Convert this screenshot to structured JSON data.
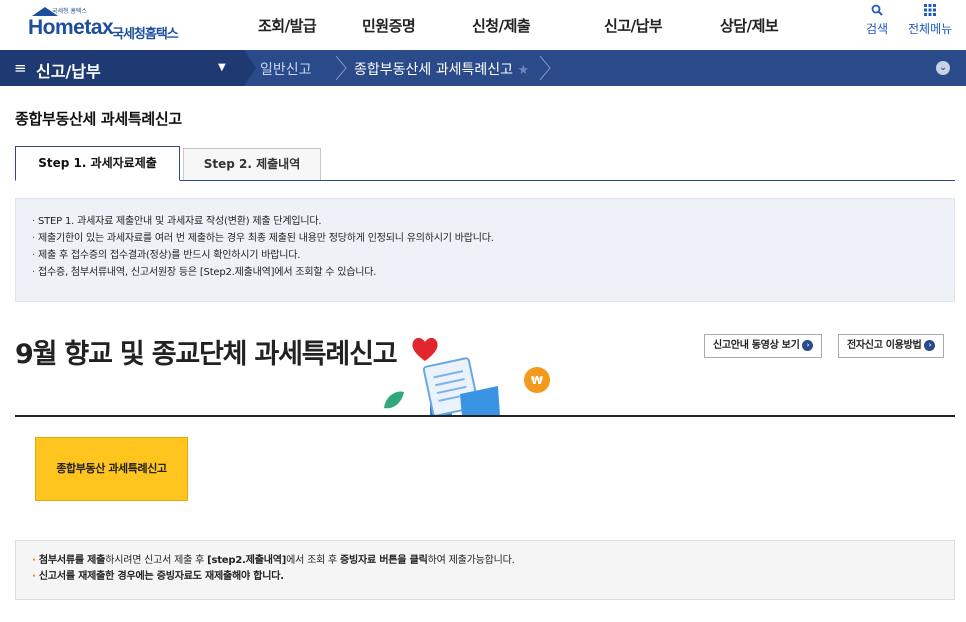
{
  "header": {
    "logo_small": "국세청 홈택스",
    "logo_text": "Hometax",
    "logo_kr": "국세청홈택스",
    "nav": [
      "조회/발급",
      "민원증명",
      "신청/제출",
      "신고/납부",
      "상담/제보"
    ],
    "util": {
      "search_label": "검색",
      "menu_label": "전체메뉴"
    }
  },
  "navbar": {
    "menu_label": "신고/납부",
    "crumbs": [
      "일반신고",
      "종합부동산세 과세특례신고"
    ]
  },
  "page": {
    "title": "종합부동산세 과세특례신고",
    "tabs": [
      {
        "label": "Step 1. 과세자료제출"
      },
      {
        "label": "Step 2. 제출내역"
      }
    ],
    "info_items": [
      "STEP 1. 과세자료 제출안내 및 과세자료 작성(변환) 제출 단계입니다.",
      "제출기한이 있는 과세자료를 여러 번 제출하는 경우 최종 제출된 내용만 정당하게 인정되니 유의하시기 바랍니다.",
      "제출 후 접수증의 접수결과(정상)를 반드시 확인하시기 바랍니다.",
      "접수증, 첨부서류내역, 신고서원장 등은 [Step2.제출내역]에서 조회할 수 있습니다."
    ]
  },
  "banner": {
    "title": "9월 향교 및 종교단체 과세특례신고",
    "btn_video": "신고안내 동영상 보기",
    "btn_howto": "전자신고 이용방법"
  },
  "action": {
    "yellow_button": "종합부동산 과세특례신고"
  },
  "notice": {
    "line1_a": "첨부서류를 제출",
    "line1_b": "하시려면 신고서 제출 후 ",
    "line1_c": "[step2.제출내역]",
    "line1_d": "에서 조회 후 ",
    "line1_e": "증빙자료 버튼을 클릭",
    "line1_f": "하여 제출가능합니다.",
    "line2": "신고서를 재제출한 경우에는 증빙자료도 재제출해야 합니다."
  },
  "colors": {
    "brand_blue": "#1e4e9c",
    "nav_bg": "#2a4a8a",
    "yellow": "#ffc51e"
  }
}
